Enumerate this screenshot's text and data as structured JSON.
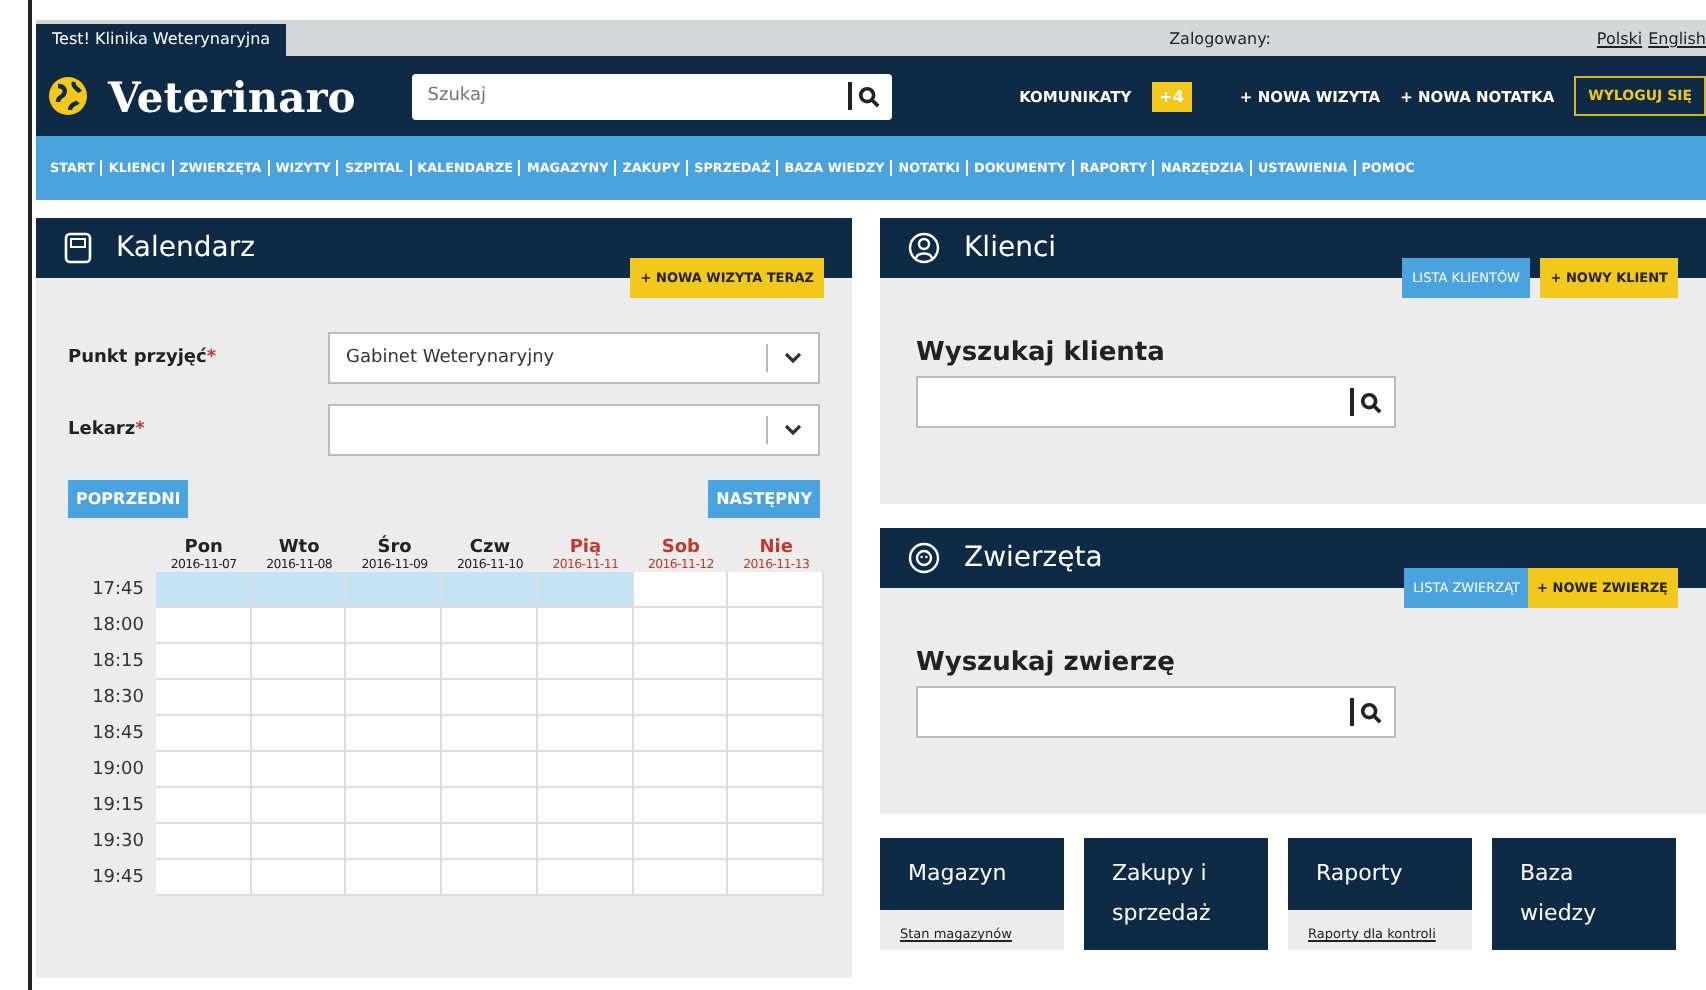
{
  "topbar": {
    "tab": "Test! Klinika Weterynaryjna",
    "logged_label": "Zalogowany:",
    "languages": [
      "Polski",
      "English"
    ]
  },
  "header": {
    "logo": "Veterinaro",
    "search_placeholder": "Szukaj",
    "messages": {
      "label": "KOMUNIKATY",
      "badge": "+4"
    },
    "links": [
      "+ NOWA WIZYTA",
      "+ NOWA NOTATKA"
    ],
    "logout": "WYLOGUJ SIĘ"
  },
  "nav": [
    "START",
    "KLIENCI",
    "ZWIERZĘTA",
    "WIZYTY",
    "SZPITAL",
    "KALENDARZE",
    "MAGAZYNY",
    "ZAKUPY",
    "SPRZEDAŻ",
    "BAZA WIEDZY",
    "NOTATKI",
    "DOKUMENTY",
    "RAPORTY",
    "NARZĘDZIA",
    "USTAWIENIA",
    "POMOC"
  ],
  "calendar": {
    "title": "Kalendarz",
    "new_button": "+ NOWA WIZYTA TERAZ",
    "fields": [
      {
        "label": "Punkt przyjęć",
        "required_mark": "*",
        "value": "Gabinet Weterynaryjny"
      },
      {
        "label": "Lekarz",
        "required_mark": "*"
      }
    ],
    "prev": "POPRZEDNI",
    "next": "NASTĘPNY",
    "days": [
      {
        "name": "Pon",
        "date": "2016-11-07",
        "holiday": false
      },
      {
        "name": "Wto",
        "date": "2016-11-08",
        "holiday": false
      },
      {
        "name": "Śro",
        "date": "2016-11-09",
        "holiday": false
      },
      {
        "name": "Czw",
        "date": "2016-11-10",
        "holiday": false
      },
      {
        "name": "Pią",
        "date": "2016-11-11",
        "holiday": true
      },
      {
        "name": "Sob",
        "date": "2016-11-12",
        "holiday": true
      },
      {
        "name": "Nie",
        "date": "2016-11-13",
        "holiday": true
      }
    ],
    "rows": [
      {
        "time": "17:45",
        "cells": [
          {
            "selected": true
          },
          {
            "selected": true
          },
          {
            "selected": true
          },
          {
            "selected": true
          },
          {
            "selected": true
          },
          {
            "selected": false
          },
          {
            "selected": false
          }
        ]
      },
      {
        "time": "18:00",
        "cells": [
          {
            "selected": false
          },
          {
            "selected": false
          },
          {
            "selected": false
          },
          {
            "selected": false
          },
          {
            "selected": false
          },
          {
            "selected": false
          },
          {
            "selected": false
          }
        ]
      },
      {
        "time": "18:15",
        "cells": [
          {
            "selected": false
          },
          {
            "selected": false
          },
          {
            "selected": false
          },
          {
            "selected": false
          },
          {
            "selected": false
          },
          {
            "selected": false
          },
          {
            "selected": false
          }
        ]
      },
      {
        "time": "18:30",
        "cells": [
          {
            "selected": false
          },
          {
            "selected": false
          },
          {
            "selected": false
          },
          {
            "selected": false
          },
          {
            "selected": false
          },
          {
            "selected": false
          },
          {
            "selected": false
          }
        ]
      },
      {
        "time": "18:45",
        "cells": [
          {
            "selected": false
          },
          {
            "selected": false
          },
          {
            "selected": false
          },
          {
            "selected": false
          },
          {
            "selected": false
          },
          {
            "selected": false
          },
          {
            "selected": false
          }
        ]
      },
      {
        "time": "19:00",
        "cells": [
          {
            "selected": false
          },
          {
            "selected": false
          },
          {
            "selected": false
          },
          {
            "selected": false
          },
          {
            "selected": false
          },
          {
            "selected": false
          },
          {
            "selected": false
          }
        ]
      },
      {
        "time": "19:15",
        "cells": [
          {
            "selected": false
          },
          {
            "selected": false
          },
          {
            "selected": false
          },
          {
            "selected": false
          },
          {
            "selected": false
          },
          {
            "selected": false
          },
          {
            "selected": false
          }
        ]
      },
      {
        "time": "19:30",
        "cells": [
          {
            "selected": false
          },
          {
            "selected": false
          },
          {
            "selected": false
          },
          {
            "selected": false
          },
          {
            "selected": false
          },
          {
            "selected": false
          },
          {
            "selected": false
          }
        ]
      },
      {
        "time": "19:45",
        "cells": [
          {
            "selected": false
          },
          {
            "selected": false
          },
          {
            "selected": false
          },
          {
            "selected": false
          },
          {
            "selected": false
          },
          {
            "selected": false
          },
          {
            "selected": false
          }
        ]
      }
    ]
  },
  "panels": [
    {
      "kind": "person",
      "title": "Klienci",
      "list_button": "LISTA KLIENTÓW",
      "new_button": "+ NOWY KLIENT",
      "search_label": "Wyszukaj klienta"
    },
    {
      "kind": "animal",
      "title": "Zwierzęta",
      "list_button": "LISTA ZWIERZĄT",
      "new_button": "+ NOWE ZWIERZĘ",
      "search_label": "Wyszukaj zwierzę"
    }
  ],
  "cards": [
    {
      "title": "Magazyn",
      "links": [
        "Stan magazynów"
      ]
    },
    {
      "title": "Zakupy i sprzedaż"
    },
    {
      "title": "Raporty",
      "links": [
        "Raporty dla kontroli"
      ]
    },
    {
      "title": "Baza wiedzy"
    }
  ]
}
